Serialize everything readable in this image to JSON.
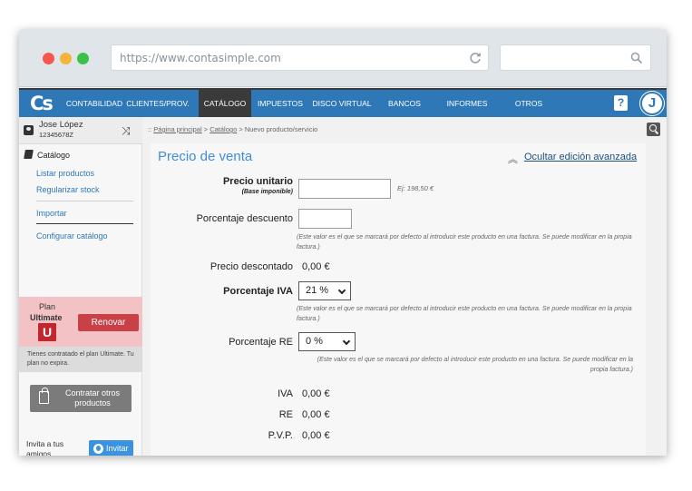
{
  "browser": {
    "url": "https://www.contasimple.com"
  },
  "nav": {
    "logo": "Cs",
    "items": [
      "CONTABILIDAD",
      "CLIENTES/PROV.",
      "CATÁLOGO",
      "IMPUESTOS",
      "DISCO VIRTUAL",
      "BANCOS",
      "INFORMES",
      "OTROS"
    ],
    "active": "CATÁLOGO",
    "help": "?",
    "avatar": "J"
  },
  "sidebar": {
    "user_name": "Jose López",
    "user_id": "12345678Z",
    "section": "Catálogo",
    "links": [
      "Listar productos",
      "Regularizar stock",
      "Importar",
      "Configurar catálogo"
    ],
    "plan_label": "Plan",
    "plan_name": "Ultimate",
    "plan_badge": "U",
    "renew_label": "Renovar",
    "plan_info": "Tienes contratado el plan Ultimate. Tu plan no expira.",
    "contract_label": "Contratar otros productos",
    "invite_text": "Invita a tus amigos",
    "invite_label": "Invitar"
  },
  "breadcrumb": {
    "prefix": "::",
    "home": "Página principal",
    "sep": ">",
    "catalog": "Catálogo",
    "current": "Nuevo producto/servicio"
  },
  "form": {
    "title": "Precio de venta",
    "advanced_link": "Ocultar edición avanzada",
    "unit_price_label": "Precio unitario",
    "unit_price_sub": "(Base imponible)",
    "unit_price_value": "",
    "unit_price_hint": "Ej: 198,50 €",
    "discount_label": "Porcentaje descuento",
    "discount_value": "",
    "discount_note": "(Este valor es el que se marcará por defecto al introducir este producto en una factura. Se puede modificar en la propia factura.)",
    "discounted_label": "Precio descontado",
    "discounted_value": "0,00 €",
    "iva_label": "Porcentaje IVA",
    "iva_selected": "21 %",
    "iva_note": "(Este valor es el que se marcará por defecto al introducir este producto en una factura. Se puede modificar en la propia factura.)",
    "re_label": "Porcentaje RE",
    "re_selected": "0 %",
    "re_note": "(Este valor es el que se marcará por defecto al introducir este producto en una factura. Se puede modificar en la propia factura.)",
    "totals": [
      {
        "label": "IVA",
        "value": "0,00 €"
      },
      {
        "label": "RE",
        "value": "0,00 €"
      },
      {
        "label": "P.V.P.",
        "value": "0,00 €"
      }
    ]
  }
}
